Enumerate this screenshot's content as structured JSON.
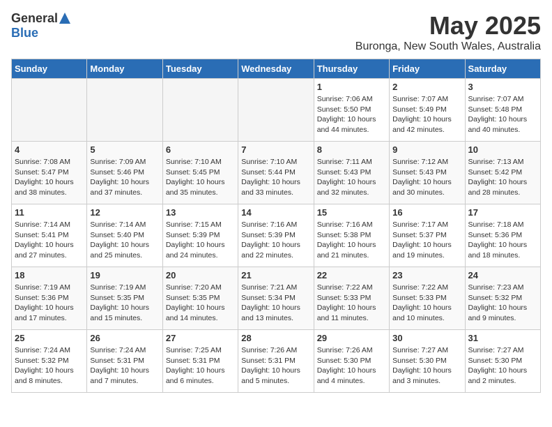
{
  "header": {
    "logo_general": "General",
    "logo_blue": "Blue",
    "month": "May 2025",
    "location": "Buronga, New South Wales, Australia"
  },
  "days_of_week": [
    "Sunday",
    "Monday",
    "Tuesday",
    "Wednesday",
    "Thursday",
    "Friday",
    "Saturday"
  ],
  "weeks": [
    [
      {
        "day": "",
        "empty": true
      },
      {
        "day": "",
        "empty": true
      },
      {
        "day": "",
        "empty": true
      },
      {
        "day": "",
        "empty": true
      },
      {
        "day": "1",
        "sunrise": "7:06 AM",
        "sunset": "5:50 PM",
        "daylight": "10 hours and 44 minutes."
      },
      {
        "day": "2",
        "sunrise": "7:07 AM",
        "sunset": "5:49 PM",
        "daylight": "10 hours and 42 minutes."
      },
      {
        "day": "3",
        "sunrise": "7:07 AM",
        "sunset": "5:48 PM",
        "daylight": "10 hours and 40 minutes."
      }
    ],
    [
      {
        "day": "4",
        "sunrise": "7:08 AM",
        "sunset": "5:47 PM",
        "daylight": "10 hours and 38 minutes."
      },
      {
        "day": "5",
        "sunrise": "7:09 AM",
        "sunset": "5:46 PM",
        "daylight": "10 hours and 37 minutes."
      },
      {
        "day": "6",
        "sunrise": "7:10 AM",
        "sunset": "5:45 PM",
        "daylight": "10 hours and 35 minutes."
      },
      {
        "day": "7",
        "sunrise": "7:10 AM",
        "sunset": "5:44 PM",
        "daylight": "10 hours and 33 minutes."
      },
      {
        "day": "8",
        "sunrise": "7:11 AM",
        "sunset": "5:43 PM",
        "daylight": "10 hours and 32 minutes."
      },
      {
        "day": "9",
        "sunrise": "7:12 AM",
        "sunset": "5:43 PM",
        "daylight": "10 hours and 30 minutes."
      },
      {
        "day": "10",
        "sunrise": "7:13 AM",
        "sunset": "5:42 PM",
        "daylight": "10 hours and 28 minutes."
      }
    ],
    [
      {
        "day": "11",
        "sunrise": "7:14 AM",
        "sunset": "5:41 PM",
        "daylight": "10 hours and 27 minutes."
      },
      {
        "day": "12",
        "sunrise": "7:14 AM",
        "sunset": "5:40 PM",
        "daylight": "10 hours and 25 minutes."
      },
      {
        "day": "13",
        "sunrise": "7:15 AM",
        "sunset": "5:39 PM",
        "daylight": "10 hours and 24 minutes."
      },
      {
        "day": "14",
        "sunrise": "7:16 AM",
        "sunset": "5:39 PM",
        "daylight": "10 hours and 22 minutes."
      },
      {
        "day": "15",
        "sunrise": "7:16 AM",
        "sunset": "5:38 PM",
        "daylight": "10 hours and 21 minutes."
      },
      {
        "day": "16",
        "sunrise": "7:17 AM",
        "sunset": "5:37 PM",
        "daylight": "10 hours and 19 minutes."
      },
      {
        "day": "17",
        "sunrise": "7:18 AM",
        "sunset": "5:36 PM",
        "daylight": "10 hours and 18 minutes."
      }
    ],
    [
      {
        "day": "18",
        "sunrise": "7:19 AM",
        "sunset": "5:36 PM",
        "daylight": "10 hours and 17 minutes."
      },
      {
        "day": "19",
        "sunrise": "7:19 AM",
        "sunset": "5:35 PM",
        "daylight": "10 hours and 15 minutes."
      },
      {
        "day": "20",
        "sunrise": "7:20 AM",
        "sunset": "5:35 PM",
        "daylight": "10 hours and 14 minutes."
      },
      {
        "day": "21",
        "sunrise": "7:21 AM",
        "sunset": "5:34 PM",
        "daylight": "10 hours and 13 minutes."
      },
      {
        "day": "22",
        "sunrise": "7:22 AM",
        "sunset": "5:33 PM",
        "daylight": "10 hours and 11 minutes."
      },
      {
        "day": "23",
        "sunrise": "7:22 AM",
        "sunset": "5:33 PM",
        "daylight": "10 hours and 10 minutes."
      },
      {
        "day": "24",
        "sunrise": "7:23 AM",
        "sunset": "5:32 PM",
        "daylight": "10 hours and 9 minutes."
      }
    ],
    [
      {
        "day": "25",
        "sunrise": "7:24 AM",
        "sunset": "5:32 PM",
        "daylight": "10 hours and 8 minutes."
      },
      {
        "day": "26",
        "sunrise": "7:24 AM",
        "sunset": "5:31 PM",
        "daylight": "10 hours and 7 minutes."
      },
      {
        "day": "27",
        "sunrise": "7:25 AM",
        "sunset": "5:31 PM",
        "daylight": "10 hours and 6 minutes."
      },
      {
        "day": "28",
        "sunrise": "7:26 AM",
        "sunset": "5:31 PM",
        "daylight": "10 hours and 5 minutes."
      },
      {
        "day": "29",
        "sunrise": "7:26 AM",
        "sunset": "5:30 PM",
        "daylight": "10 hours and 4 minutes."
      },
      {
        "day": "30",
        "sunrise": "7:27 AM",
        "sunset": "5:30 PM",
        "daylight": "10 hours and 3 minutes."
      },
      {
        "day": "31",
        "sunrise": "7:27 AM",
        "sunset": "5:30 PM",
        "daylight": "10 hours and 2 minutes."
      }
    ]
  ]
}
